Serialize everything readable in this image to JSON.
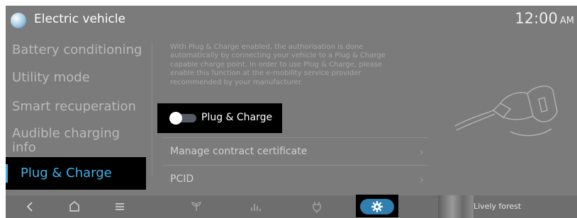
{
  "header": {
    "title": "Electric vehicle",
    "time": "12:00",
    "ampm": "AM"
  },
  "sidebar": {
    "items": [
      {
        "label": "Battery conditioning"
      },
      {
        "label": "Utility mode"
      },
      {
        "label": "Smart recuperation"
      },
      {
        "label_line1": "Audible charging",
        "label_line2": "info"
      },
      {
        "label": "Plug & Charge",
        "active": true
      }
    ]
  },
  "content": {
    "description_lines": [
      "With Plug & Charge enabled, the authorisation is done",
      "automatically by connecting your vehicle to a Plug & Charge",
      "capable charge point. In order to use Plug & Charge, please",
      "enable this function at the e-mobility service provider",
      "recommended by your manufacturer."
    ],
    "toggle": {
      "label": "Plug & Charge",
      "enabled": false
    },
    "rows": [
      {
        "label": "Manage contract certificate"
      },
      {
        "label": "PCID"
      }
    ]
  },
  "bottom_bar": {
    "icons": [
      "back-icon",
      "home-icon",
      "menu-icon",
      "eco-icon",
      "equalizer-icon",
      "charging-icon",
      "settings-icon"
    ],
    "media": {
      "title": "Lively forest"
    }
  },
  "colors": {
    "accent": "#3fb1e8",
    "background": "#7b7b7b",
    "highlight": "#000000",
    "settings_pill": "#2f7fb0"
  }
}
